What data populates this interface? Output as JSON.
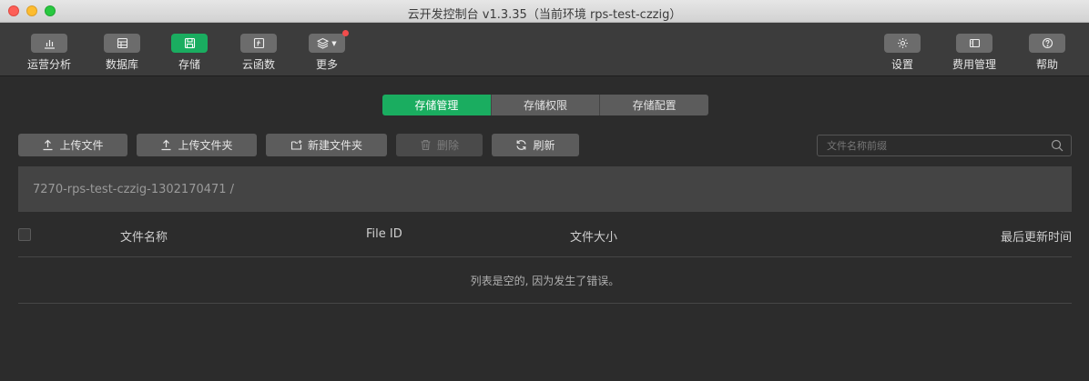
{
  "window": {
    "title": "云开发控制台 v1.3.35（当前环境 rps-test-czzig）"
  },
  "toolbar": {
    "left_items": [
      {
        "label": "运营分析",
        "icon": "bar-chart-icon"
      },
      {
        "label": "数据库",
        "icon": "database-icon"
      },
      {
        "label": "存储",
        "icon": "storage-icon",
        "active": true
      },
      {
        "label": "云函数",
        "icon": "cloud-function-icon"
      },
      {
        "label": "更多",
        "icon": "layers-icon",
        "has_badge": true
      }
    ],
    "right_items": [
      {
        "label": "设置",
        "icon": "gear-icon"
      },
      {
        "label": "费用管理",
        "icon": "billing-icon"
      },
      {
        "label": "帮助",
        "icon": "help-icon"
      }
    ]
  },
  "tabs": [
    {
      "label": "存储管理",
      "active": true
    },
    {
      "label": "存储权限",
      "active": false
    },
    {
      "label": "存储配置",
      "active": false
    }
  ],
  "actions": {
    "upload_file": "上传文件",
    "upload_folder": "上传文件夹",
    "new_folder": "新建文件夹",
    "delete": "删除",
    "refresh": "刷新"
  },
  "search": {
    "placeholder": "文件名称前缀",
    "value": ""
  },
  "path": "7270-rps-test-czzig-1302170471 /",
  "table": {
    "columns": [
      "文件名称",
      "File ID",
      "文件大小",
      "最后更新时间"
    ],
    "empty_message": "列表是空的, 因为发生了错误。"
  },
  "colors": {
    "accent": "#1aad60",
    "badge": "#f14c4c",
    "background": "#2c2c2c",
    "toolbar": "#3c3c3c"
  }
}
